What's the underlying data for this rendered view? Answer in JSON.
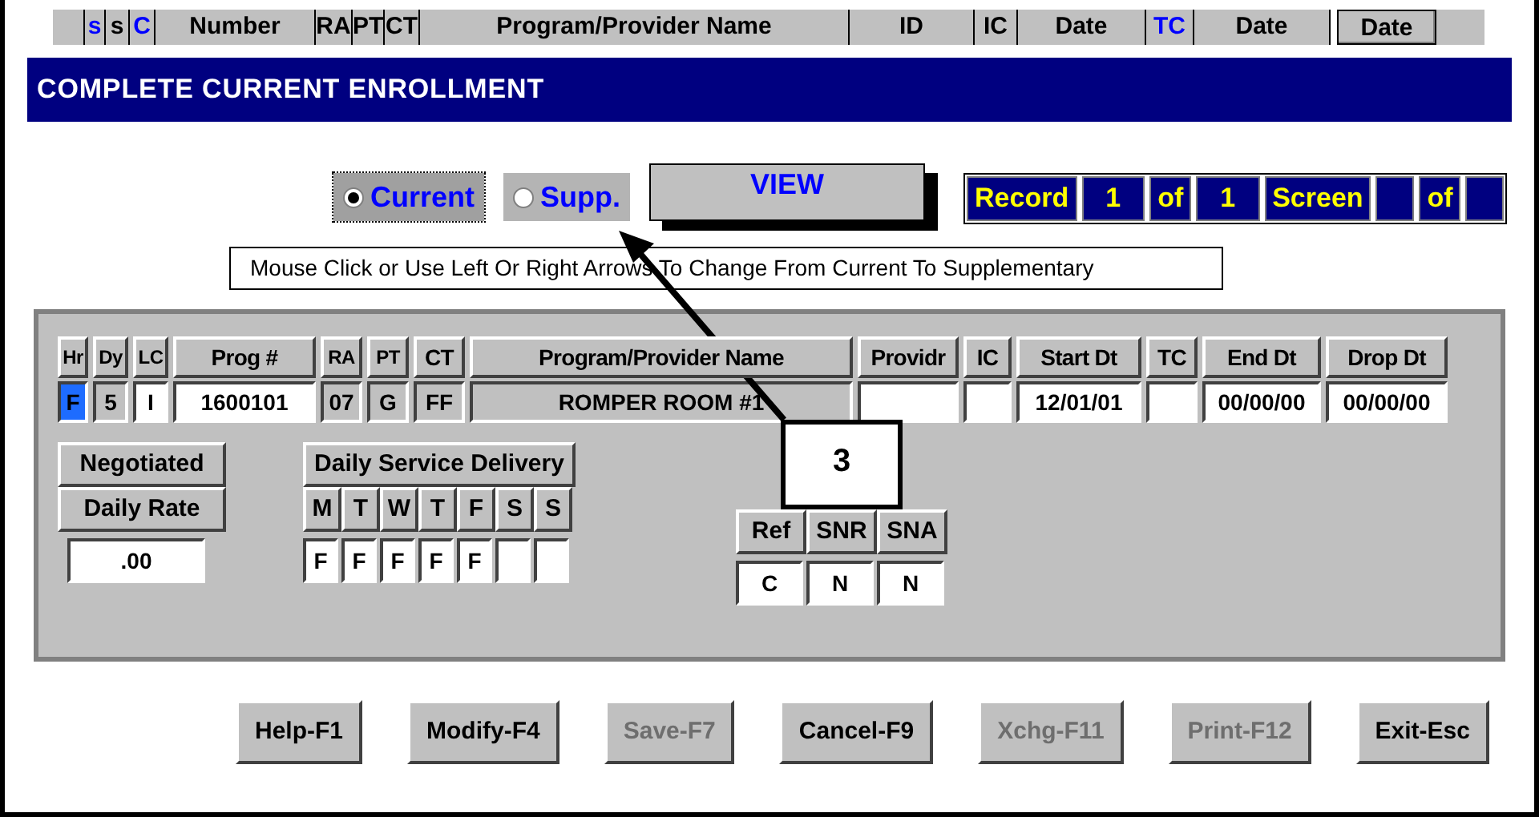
{
  "column_strip": [
    {
      "label": "s",
      "color": "#0000ff"
    },
    {
      "label": "s",
      "color": "#000000"
    },
    {
      "label": "C",
      "color": "#0000ff"
    },
    {
      "label": "Number",
      "color": "#000000"
    },
    {
      "label": "RA",
      "color": "#000000"
    },
    {
      "label": "PT",
      "color": "#000000"
    },
    {
      "label": "CT",
      "color": "#000000"
    },
    {
      "label": "Program/Provider Name",
      "color": "#000000"
    },
    {
      "label": "ID",
      "color": "#000000"
    },
    {
      "label": "IC",
      "color": "#000000"
    },
    {
      "label": "Date",
      "color": "#000000"
    },
    {
      "label": "TC",
      "color": "#0000ff"
    },
    {
      "label": "Date",
      "color": "#000000"
    },
    {
      "label": "Date",
      "color": "#000000"
    }
  ],
  "title": "COMPLETE CURRENT ENROLLMENT",
  "mode_options": [
    {
      "label": "Current",
      "selected": true
    },
    {
      "label": "Supp.",
      "selected": false
    }
  ],
  "view_button": "VIEW",
  "record_nav": [
    {
      "kind": "label",
      "text": "Record"
    },
    {
      "kind": "value",
      "text": "1"
    },
    {
      "kind": "label",
      "text": "of"
    },
    {
      "kind": "value",
      "text": "1"
    },
    {
      "kind": "label",
      "text": "Screen"
    },
    {
      "kind": "value"
    },
    {
      "kind": "label",
      "text": "of"
    },
    {
      "kind": "value"
    }
  ],
  "hint": "Mouse Click or Use Left Or Right Arrows To Change From Current To Supplementary",
  "enrollment": {
    "columns": [
      "Hr",
      "Dy",
      "LC",
      "Prog #",
      "RA",
      "PT",
      "CT",
      "Program/Provider Name",
      "Providr",
      "IC",
      "Start Dt",
      "TC",
      "End Dt",
      "Drop Dt"
    ],
    "values": [
      {
        "text": "F",
        "kind": "focused"
      },
      {
        "text": "5",
        "kind": "readonly"
      },
      {
        "text": "I",
        "kind": "input"
      },
      {
        "text": "1600101",
        "kind": "input"
      },
      {
        "text": "07",
        "kind": "readonly"
      },
      {
        "text": "G",
        "kind": "readonly"
      },
      {
        "text": "FF",
        "kind": "readonly"
      },
      {
        "text": "ROMPER ROOM #1",
        "kind": "readonly"
      },
      {
        "kind": "input"
      },
      {
        "kind": "input"
      },
      {
        "text": "12/01/01",
        "kind": "input"
      },
      {
        "kind": "input"
      },
      {
        "text": "00/00/00",
        "kind": "input"
      },
      {
        "text": "00/00/00",
        "kind": "input"
      }
    ]
  },
  "rate": {
    "labels": [
      "Negotiated",
      "Daily Rate"
    ],
    "value": ".00"
  },
  "service_delivery": {
    "title": "Daily Service Delivery",
    "days": [
      "M",
      "T",
      "W",
      "T",
      "F",
      "S",
      "S"
    ],
    "values": [
      {
        "kind": "entry",
        "text": "F"
      },
      {
        "kind": "entry",
        "text": "F"
      },
      {
        "kind": "entry",
        "text": "F"
      },
      {
        "kind": "entry",
        "text": "F"
      },
      {
        "kind": "entry",
        "text": "F"
      },
      {
        "kind": "empty"
      },
      {
        "kind": "empty"
      }
    ]
  },
  "referral": {
    "columns": [
      "Ref",
      "SNR",
      "SNA"
    ],
    "values": [
      "C",
      "N",
      "N"
    ]
  },
  "buttons": [
    {
      "label": "Help-F1",
      "disabled": false
    },
    {
      "label": "Modify-F4",
      "disabled": false
    },
    {
      "label": "Save-F7",
      "disabled": true
    },
    {
      "label": "Cancel-F9",
      "disabled": false
    },
    {
      "label": "Xchg-F11",
      "disabled": true
    },
    {
      "label": "Print-F12",
      "disabled": true
    },
    {
      "label": "Exit-Esc",
      "disabled": false
    }
  ],
  "callout": "3"
}
